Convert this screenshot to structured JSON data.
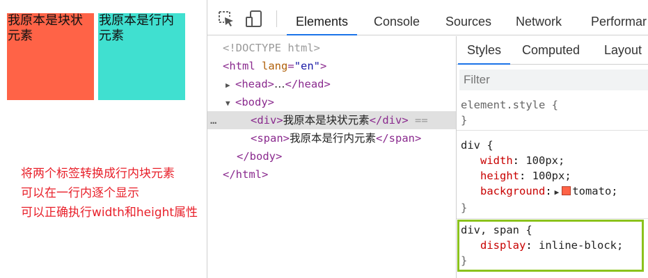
{
  "preview": {
    "block_text": "我原本是块状元素",
    "inline_text": "我原本是行内元素",
    "notes": [
      "将两个标签转换成行内块元素",
      "可以在一行内逐个显示",
      "可以正确执行width和height属性"
    ],
    "colors": {
      "block_bg": "#ff6347",
      "inline_bg": "#40e0d0",
      "note": "#e8202a"
    }
  },
  "toolbar": {
    "icons": [
      "inspect-element-icon",
      "device-toggle-icon"
    ],
    "tabs": [
      "Elements",
      "Console",
      "Sources",
      "Network",
      "Performar"
    ],
    "active_tab": "Elements"
  },
  "dom": {
    "doctype": "<!DOCTYPE html>",
    "html_open_tag": "<html",
    "html_attr": "lang",
    "html_attr_val": "\"en\"",
    "html_open_end": ">",
    "head_open": "<head>",
    "head_ellipsis": "…",
    "head_close": "</head>",
    "body_open": "<body>",
    "div_open": "<div>",
    "div_text": "我原本是块状元素",
    "div_close": "</div>",
    "div_suffix": "==",
    "span_open": "<span>",
    "span_text": "我原本是行内元素",
    "span_close": "</span>",
    "body_close": "</body>",
    "html_close": "</html>",
    "ellipsis": "…"
  },
  "styles": {
    "tabs": [
      "Styles",
      "Computed",
      "Layout"
    ],
    "active_tab": "Styles",
    "filter_placeholder": "Filter",
    "element_style": {
      "selector": "element.style {",
      "close": "}"
    },
    "div_rule": {
      "selector": "div {",
      "props": [
        {
          "name": "width",
          "value": "100px;"
        },
        {
          "name": "height",
          "value": "100px;"
        },
        {
          "name": "background",
          "value": "tomato;"
        }
      ],
      "close": "}"
    },
    "div_span_rule": {
      "selector": "div, span {",
      "props": [
        {
          "name": "display",
          "value": "inline-block;"
        }
      ],
      "close": "}"
    },
    "highlight_color": "#8bc21c",
    "accent": "#1a73e8"
  }
}
